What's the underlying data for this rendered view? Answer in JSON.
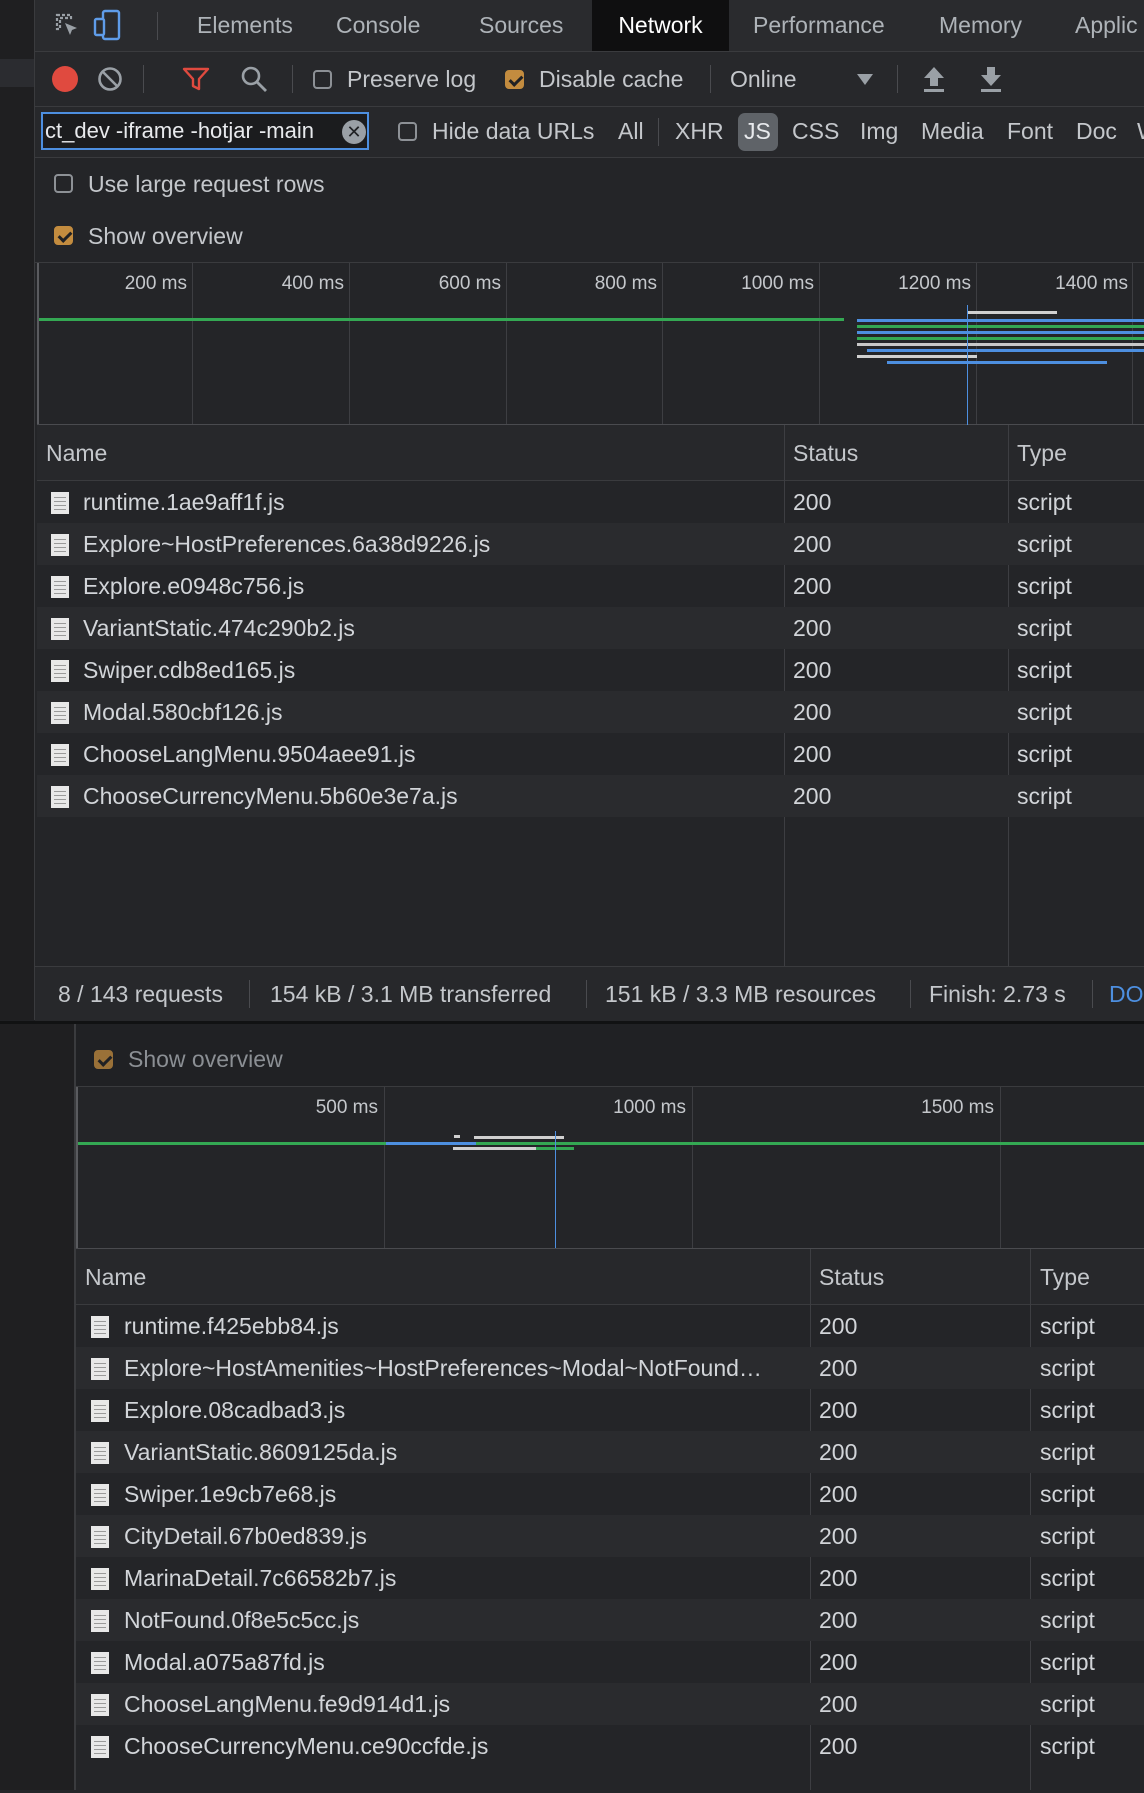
{
  "tabs": [
    "Elements",
    "Console",
    "Sources",
    "Network",
    "Performance",
    "Memory",
    "Applic"
  ],
  "active_tab": "Network",
  "toolbar": {
    "preserve_log": "Preserve log",
    "disable_cache": "Disable cache",
    "throttle": "Online",
    "preserve_log_checked": false,
    "disable_cache_checked": true
  },
  "filter": {
    "value": "ct_dev -iframe -hotjar -main",
    "hide_data_urls": "Hide data URLs",
    "types": [
      "All",
      "XHR",
      "JS",
      "CSS",
      "Img",
      "Media",
      "Font",
      "Doc",
      "W"
    ],
    "active_type": "JS"
  },
  "settings": {
    "large_rows": "Use large request rows",
    "show_overview": "Show overview"
  },
  "overview_a": {
    "ticks": [
      "200 ms",
      "400 ms",
      "600 ms",
      "800 ms",
      "1000 ms",
      "1200 ms",
      "1400 ms"
    ]
  },
  "table_a": {
    "headers": {
      "name": "Name",
      "status": "Status",
      "type": "Type"
    },
    "rows": [
      {
        "name": "runtime.1ae9aff1f.js",
        "status": "200",
        "type": "script"
      },
      {
        "name": "Explore~HostPreferences.6a38d9226.js",
        "status": "200",
        "type": "script"
      },
      {
        "name": "Explore.e0948c756.js",
        "status": "200",
        "type": "script"
      },
      {
        "name": "VariantStatic.474c290b2.js",
        "status": "200",
        "type": "script"
      },
      {
        "name": "Swiper.cdb8ed165.js",
        "status": "200",
        "type": "script"
      },
      {
        "name": "Modal.580cbf126.js",
        "status": "200",
        "type": "script"
      },
      {
        "name": "ChooseLangMenu.9504aee91.js",
        "status": "200",
        "type": "script"
      },
      {
        "name": "ChooseCurrencyMenu.5b60e3e7a.js",
        "status": "200",
        "type": "script"
      }
    ]
  },
  "status_bar": {
    "requests": "8 / 143 requests",
    "transferred": "154 kB / 3.1 MB transferred",
    "resources": "151 kB / 3.3 MB resources",
    "finish": "Finish: 2.73 s",
    "dom": "DO"
  },
  "panel_b": {
    "show_overview": "Show overview",
    "ticks": [
      "500 ms",
      "1000 ms",
      "1500 ms"
    ],
    "headers": {
      "name": "Name",
      "status": "Status",
      "type": "Type"
    },
    "rows": [
      {
        "name": "runtime.f425ebb84.js",
        "status": "200",
        "type": "script"
      },
      {
        "name": "Explore~HostAmenities~HostPreferences~Modal~NotFound…",
        "status": "200",
        "type": "script"
      },
      {
        "name": "Explore.08cadbad3.js",
        "status": "200",
        "type": "script"
      },
      {
        "name": "VariantStatic.8609125da.js",
        "status": "200",
        "type": "script"
      },
      {
        "name": "Swiper.1e9cb7e68.js",
        "status": "200",
        "type": "script"
      },
      {
        "name": "CityDetail.67b0ed839.js",
        "status": "200",
        "type": "script"
      },
      {
        "name": "MarinaDetail.7c66582b7.js",
        "status": "200",
        "type": "script"
      },
      {
        "name": "NotFound.0f8e5c5cc.js",
        "status": "200",
        "type": "script"
      },
      {
        "name": "Modal.a075a87fd.js",
        "status": "200",
        "type": "script"
      },
      {
        "name": "ChooseLangMenu.fe9d914d1.js",
        "status": "200",
        "type": "script"
      },
      {
        "name": "ChooseCurrencyMenu.ce90ccfde.js",
        "status": "200",
        "type": "script"
      }
    ]
  },
  "colors": {
    "record": "#e04a3f",
    "filter": "#e04a3f",
    "checkbox_on": "#c38c3f",
    "accent": "#4d8fe0",
    "waterfall_green": "#34a853",
    "waterfall_blue": "#4d8fe0"
  },
  "icons": [
    "inspect-icon",
    "device-toggle-icon",
    "record-icon",
    "clear-icon",
    "filter-icon",
    "search-icon",
    "dropdown-arrow-icon",
    "upload-icon",
    "download-icon",
    "clear-input-icon",
    "file-icon"
  ]
}
